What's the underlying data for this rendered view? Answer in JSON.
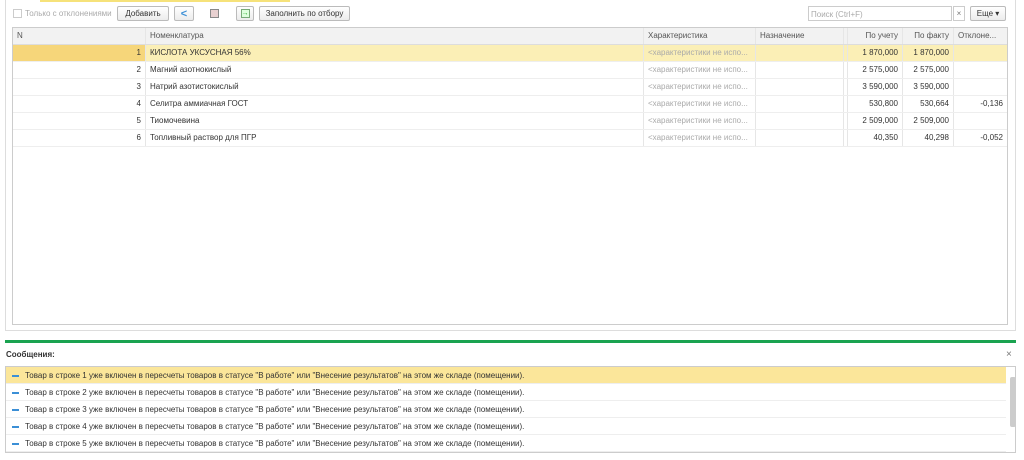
{
  "toolbar": {
    "only_deviations": "Только с отклонениями",
    "add": "Добавить",
    "fill": "Заполнить по отбору",
    "search_placeholder": "Поиск (Ctrl+F)",
    "clear": "×",
    "more": "Еще ▾"
  },
  "table": {
    "headers": [
      "N",
      "Номенклатура",
      "Характеристика",
      "Назначение",
      "По учету",
      "По факту",
      "Отклоне..."
    ],
    "rows": [
      {
        "n": "1",
        "name": "КИСЛОТА УКСУСНАЯ 56%",
        "char": "<характеристики не испо...",
        "dest": "",
        "book": "1 870,000",
        "fact": "1 870,000",
        "dev": ""
      },
      {
        "n": "2",
        "name": "Магний азотнокислый",
        "char": "<характеристики не испо...",
        "dest": "",
        "book": "2 575,000",
        "fact": "2 575,000",
        "dev": ""
      },
      {
        "n": "3",
        "name": "Натрий азотистокислый",
        "char": "<характеристики не испо...",
        "dest": "",
        "book": "3 590,000",
        "fact": "3 590,000",
        "dev": ""
      },
      {
        "n": "4",
        "name": "Селитра аммиачная ГОСТ",
        "char": "<характеристики не испо...",
        "dest": "",
        "book": "530,800",
        "fact": "530,664",
        "dev": "-0,136"
      },
      {
        "n": "5",
        "name": "Тиомочевина",
        "char": "<характеристики не испо...",
        "dest": "",
        "book": "2 509,000",
        "fact": "2 509,000",
        "dev": ""
      },
      {
        "n": "6",
        "name": "Топливный раствор для ПГР",
        "char": "<характеристики не испо...",
        "dest": "",
        "book": "40,350",
        "fact": "40,298",
        "dev": "-0,052"
      }
    ]
  },
  "messages": {
    "title": "Сообщения:",
    "close": "×",
    "items": [
      "Товар в строке 1 уже включен в пересчеты товаров в статусе \"В работе\" или \"Внесение результатов\" на этом же складе (помещении).",
      "Товар в строке 2 уже включен в пересчеты товаров в статусе \"В работе\" или \"Внесение результатов\" на этом же складе (помещении).",
      "Товар в строке 3 уже включен в пересчеты товаров в статусе \"В работе\" или \"Внесение результатов\" на этом же складе (помещении).",
      "Товар в строке 4 уже включен в пересчеты товаров в статусе \"В работе\" или \"Внесение результатов\" на этом же складе (помещении).",
      "Товар в строке 5 уже включен в пересчеты товаров в статусе \"В работе\" или \"Внесение результатов\" на этом же складе (помещении)."
    ]
  }
}
